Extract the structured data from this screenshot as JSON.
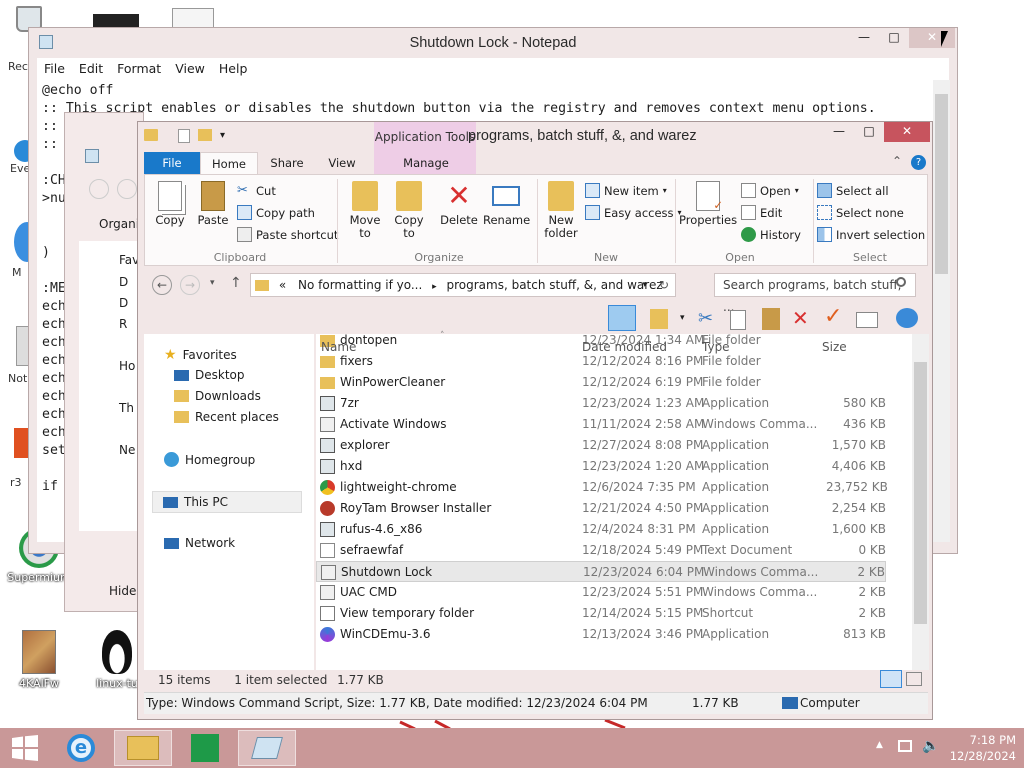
{
  "desktop": {
    "icons": [
      {
        "label": "4KAlFw"
      },
      {
        "label": "linux-tu"
      },
      {
        "label": "Supermium"
      }
    ],
    "partial_labels": [
      "Rec",
      "Eve",
      "M",
      "Not",
      "r3"
    ]
  },
  "notepad": {
    "title": "Shutdown Lock - Notepad",
    "menu": [
      "File",
      "Edit",
      "Format",
      "View",
      "Help"
    ],
    "lines": [
      "@echo off",
      ":: This script enables or disables the shutdown button via the registry and removes context menu options.",
      "::",
      "::",
      "",
      ":CH",
      ">nu",
      "",
      "",
      ")",
      "",
      ":MEN",
      "echo",
      "echo",
      "echo",
      "echo",
      "echo",
      "echo",
      "echo",
      "echo",
      "set",
      "",
      "if \""
    ]
  },
  "bg_window": {
    "items": [
      "Organi",
      "Fav",
      "D",
      "D",
      "R",
      "Ho",
      "Th",
      "Ne",
      "Hide"
    ]
  },
  "explorer": {
    "title": "programs, batch stuff, &, and warez",
    "context_tab": "Application Tools",
    "tabs": [
      "File",
      "Home",
      "Share",
      "View",
      "Manage"
    ],
    "ribbon": {
      "clipboard": {
        "label": "Clipboard",
        "copy": "Copy",
        "paste": "Paste",
        "cut": "Cut",
        "copy_path": "Copy path",
        "paste_shortcut": "Paste shortcut"
      },
      "organize": {
        "label": "Organize",
        "move_to": "Move to",
        "copy_to": "Copy to",
        "delete": "Delete",
        "rename": "Rename"
      },
      "new": {
        "label": "New",
        "new_folder": "New folder",
        "new_item": "New item",
        "easy_access": "Easy access"
      },
      "open": {
        "label": "Open",
        "properties": "Properties",
        "open": "Open",
        "edit": "Edit",
        "history": "History"
      },
      "select": {
        "label": "Select",
        "select_all": "Select all",
        "select_none": "Select none",
        "invert": "Invert selection"
      }
    },
    "address": {
      "prefix": "«",
      "crumb1": "No formatting if yo...",
      "crumb2": "programs, batch stuff, &, and warez"
    },
    "search_placeholder": "Search programs, batch stuff, ...",
    "nav": {
      "favorites": "Favorites",
      "desktop": "Desktop",
      "downloads": "Downloads",
      "recent": "Recent places",
      "homegroup": "Homegroup",
      "thispc": "This PC",
      "network": "Network"
    },
    "columns": {
      "name": "Name",
      "date": "Date modified",
      "type": "Type",
      "size": "Size"
    },
    "files": [
      {
        "name": "dontopen",
        "date": "12/23/2024 1:34 AM",
        "type": "File folder",
        "size": "",
        "icon": "folder"
      },
      {
        "name": "fixers",
        "date": "12/12/2024 8:16 PM",
        "type": "File folder",
        "size": "",
        "icon": "folder"
      },
      {
        "name": "WinPowerCleaner",
        "date": "12/12/2024 6:19 PM",
        "type": "File folder",
        "size": "",
        "icon": "folder"
      },
      {
        "name": "7zr",
        "date": "12/23/2024 1:23 AM",
        "type": "Application",
        "size": "580 KB",
        "icon": "app"
      },
      {
        "name": "Activate Windows",
        "date": "11/11/2024 2:58 AM",
        "type": "Windows Comma...",
        "size": "436 KB",
        "icon": "cmd"
      },
      {
        "name": "explorer",
        "date": "12/27/2024 8:08 PM",
        "type": "Application",
        "size": "1,570 KB",
        "icon": "app"
      },
      {
        "name": "hxd",
        "date": "12/23/2024 1:20 AM",
        "type": "Application",
        "size": "4,406 KB",
        "icon": "app"
      },
      {
        "name": "lightweight-chrome",
        "date": "12/6/2024 7:35 PM",
        "type": "Application",
        "size": "23,752 KB",
        "icon": "chrome"
      },
      {
        "name": "RoyTam Browser Installer",
        "date": "12/21/2024 4:50 PM",
        "type": "Application",
        "size": "2,254 KB",
        "icon": "roytam"
      },
      {
        "name": "rufus-4.6_x86",
        "date": "12/4/2024 8:31 PM",
        "type": "Application",
        "size": "1,600 KB",
        "icon": "app"
      },
      {
        "name": "sefraewfaf",
        "date": "12/18/2024 5:49 PM",
        "type": "Text Document",
        "size": "0 KB",
        "icon": "txt"
      },
      {
        "name": "Shutdown Lock",
        "date": "12/23/2024 6:04 PM",
        "type": "Windows Comma...",
        "size": "2 KB",
        "icon": "cmd",
        "selected": true
      },
      {
        "name": "UAC CMD",
        "date": "12/23/2024 5:51 PM",
        "type": "Windows Comma...",
        "size": "2 KB",
        "icon": "cmd"
      },
      {
        "name": "View temporary folder",
        "date": "12/14/2024 5:15 PM",
        "type": "Shortcut",
        "size": "2 KB",
        "icon": "shortcut"
      },
      {
        "name": "WinCDEmu-3.6",
        "date": "12/13/2024 3:46 PM",
        "type": "Application",
        "size": "813 KB",
        "icon": "wincd"
      }
    ],
    "status": {
      "items": "15 items",
      "selected": "1 item selected",
      "sel_size": "1.77 KB"
    },
    "details_bar": {
      "info": "Type: Windows Command Script, Size: 1.77 KB, Date modified: 12/23/2024 6:04 PM",
      "size": "1.77 KB",
      "location": "Computer"
    }
  },
  "taskbar": {
    "time": "7:18 PM",
    "date": "12/28/2024"
  }
}
